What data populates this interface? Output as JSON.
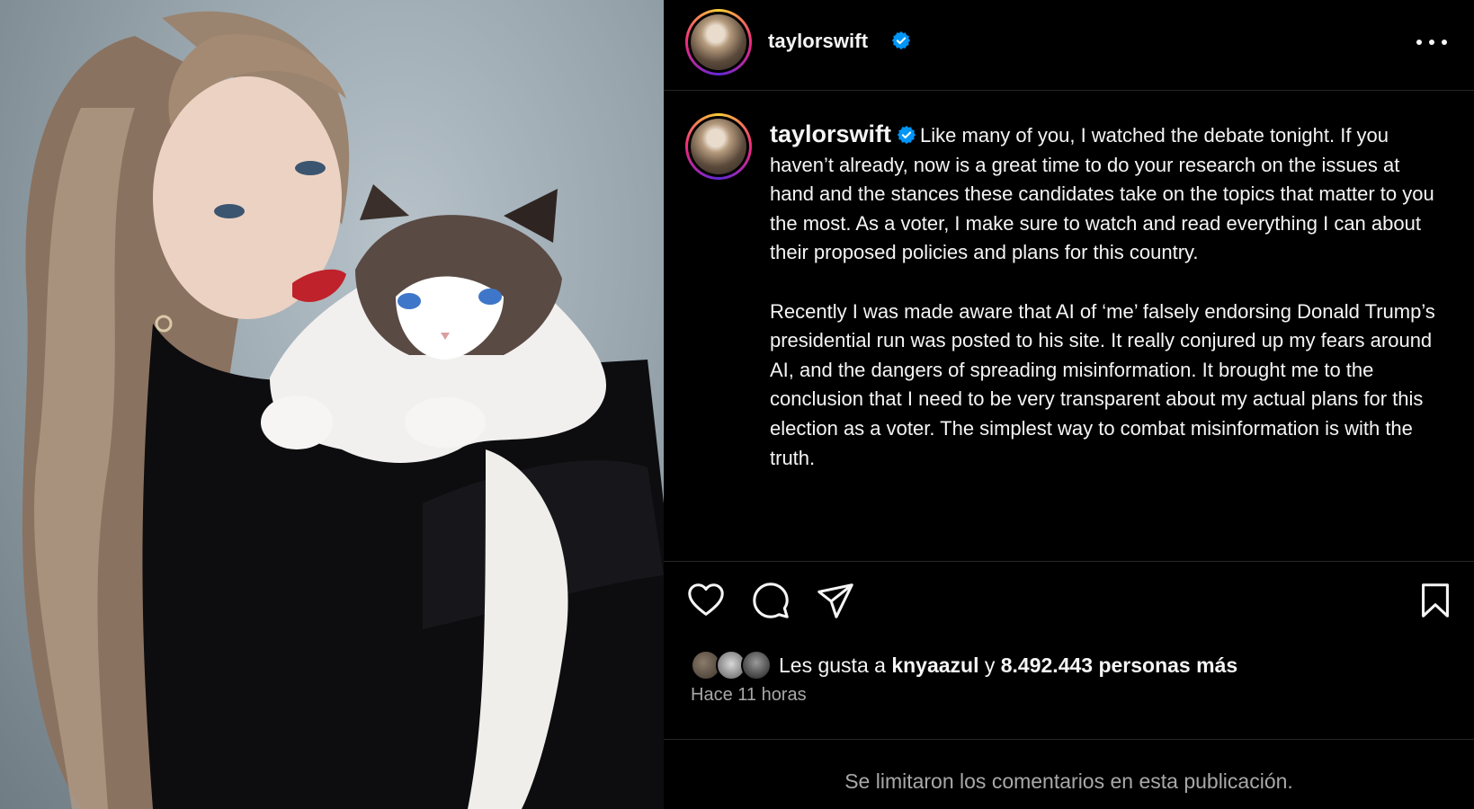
{
  "header": {
    "username": "taylorswift",
    "verified": true,
    "more_label": "More options"
  },
  "caption": {
    "username": "taylorswift",
    "paragraph1": "Like many of you, I watched the debate tonight. If you haven’t already, now is a great time to do your research on the issues at hand and the stances these candidates take on the topics that matter to you the most. As a voter, I make sure to watch and read everything I can about their proposed policies and plans for this country.",
    "paragraph2": "Recently I was made aware that AI of ‘me’ falsely endorsing Donald Trump’s presidential run was posted to his site. It really conjured up my fears around AI, and the dangers of spreading misinformation. It brought me to the conclusion that I need to be very transparent about my actual plans for this election as a voter. The simplest way to combat misinformation is with the truth."
  },
  "actions": {
    "like_icon": "heart-icon",
    "comment_icon": "comment-icon",
    "share_icon": "share-icon",
    "save_icon": "bookmark-icon"
  },
  "likes": {
    "prefix": "Les gusta a",
    "user": "knyaazul",
    "connector": "y",
    "count_text": "8.492.443 personas más"
  },
  "timestamp": "Hace 11 horas",
  "comments_notice": "Se limitaron los comentarios en esta publicación.",
  "colors": {
    "background": "#000000",
    "text": "#f5f5f5",
    "muted": "#a8a8a8",
    "verified_blue": "#0095f6",
    "divider": "#262626"
  }
}
